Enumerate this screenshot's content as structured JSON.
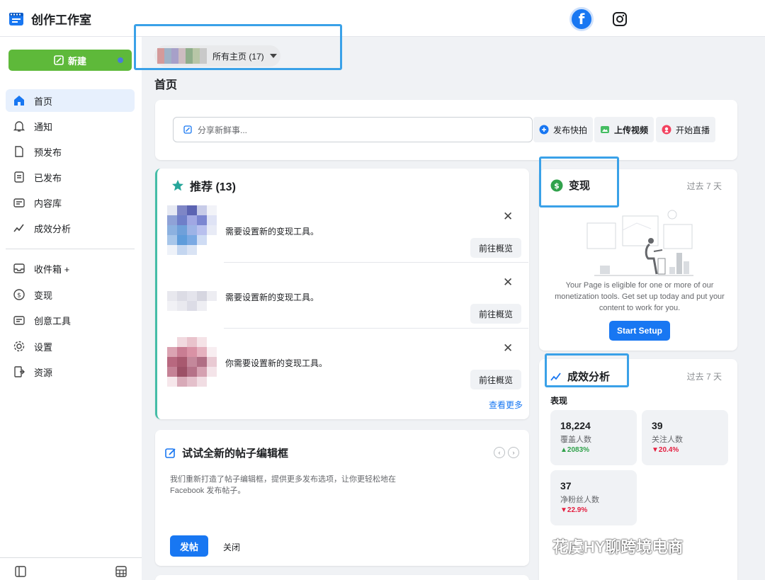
{
  "app": {
    "title": "创作工作室"
  },
  "sidebar": {
    "new_label": "新建",
    "items": [
      {
        "label": "首页",
        "icon": "home-icon"
      },
      {
        "label": "通知",
        "icon": "bell-icon"
      },
      {
        "label": "预发布",
        "icon": "draft-icon"
      },
      {
        "label": "已发布",
        "icon": "published-icon"
      },
      {
        "label": "内容库",
        "icon": "library-icon"
      },
      {
        "label": "成效分析",
        "icon": "analytics-icon"
      },
      {
        "label": "收件箱 +",
        "icon": "inbox-icon"
      },
      {
        "label": "变现",
        "icon": "dollar-icon"
      },
      {
        "label": "创意工具",
        "icon": "tools-icon"
      },
      {
        "label": "设置",
        "icon": "gear-icon"
      },
      {
        "label": "资源",
        "icon": "resources-icon"
      }
    ]
  },
  "page_switcher": {
    "label": "所有主页 (17)"
  },
  "main": {
    "title": "首页",
    "composer": {
      "placeholder": "分享新鲜事...",
      "buttons": [
        "发布快拍",
        "上传视频",
        "开始直播"
      ]
    },
    "recommendations": {
      "title": "推荐 (13)",
      "items": [
        {
          "message": "需要设置新的变现工具。",
          "action": "前往概览"
        },
        {
          "message": "需要设置新的变现工具。",
          "action": "前往概览"
        },
        {
          "message": "你需要设置新的变现工具。",
          "action": "前往概览"
        }
      ],
      "see_more": "查看更多"
    },
    "try_editor": {
      "title": "试试全新的帖子编辑框",
      "description": "我们重新打造了帖子编辑框，提供更多发布选项，让你更轻松地在 Facebook 发布帖子。",
      "post": "发帖",
      "close": "关闭"
    }
  },
  "monetization": {
    "title": "变现",
    "period": "过去 7 天",
    "description": "Your Page is eligible for one or more of our monetization tools. Get set up today and put your content to work for you.",
    "button": "Start Setup"
  },
  "performance": {
    "title": "成效分析",
    "period": "过去 7 天",
    "subtitle": "表现",
    "stats": [
      {
        "value": "18,224",
        "label": "覆盖人数",
        "delta": "2083%",
        "trend": "up"
      },
      {
        "value": "39",
        "label": "关注人数",
        "delta": "20.4%",
        "trend": "down"
      },
      {
        "value": "37",
        "label": "净粉丝人数",
        "delta": "22.9%",
        "trend": "down"
      }
    ]
  },
  "watermark": "花虞HY聊跨境电商",
  "colors": {
    "accent": "#1877f2",
    "new_button": "#5eb93a",
    "highlight_box": "#3aa1e8",
    "up": "#31a24c",
    "down": "#e41e3f"
  }
}
